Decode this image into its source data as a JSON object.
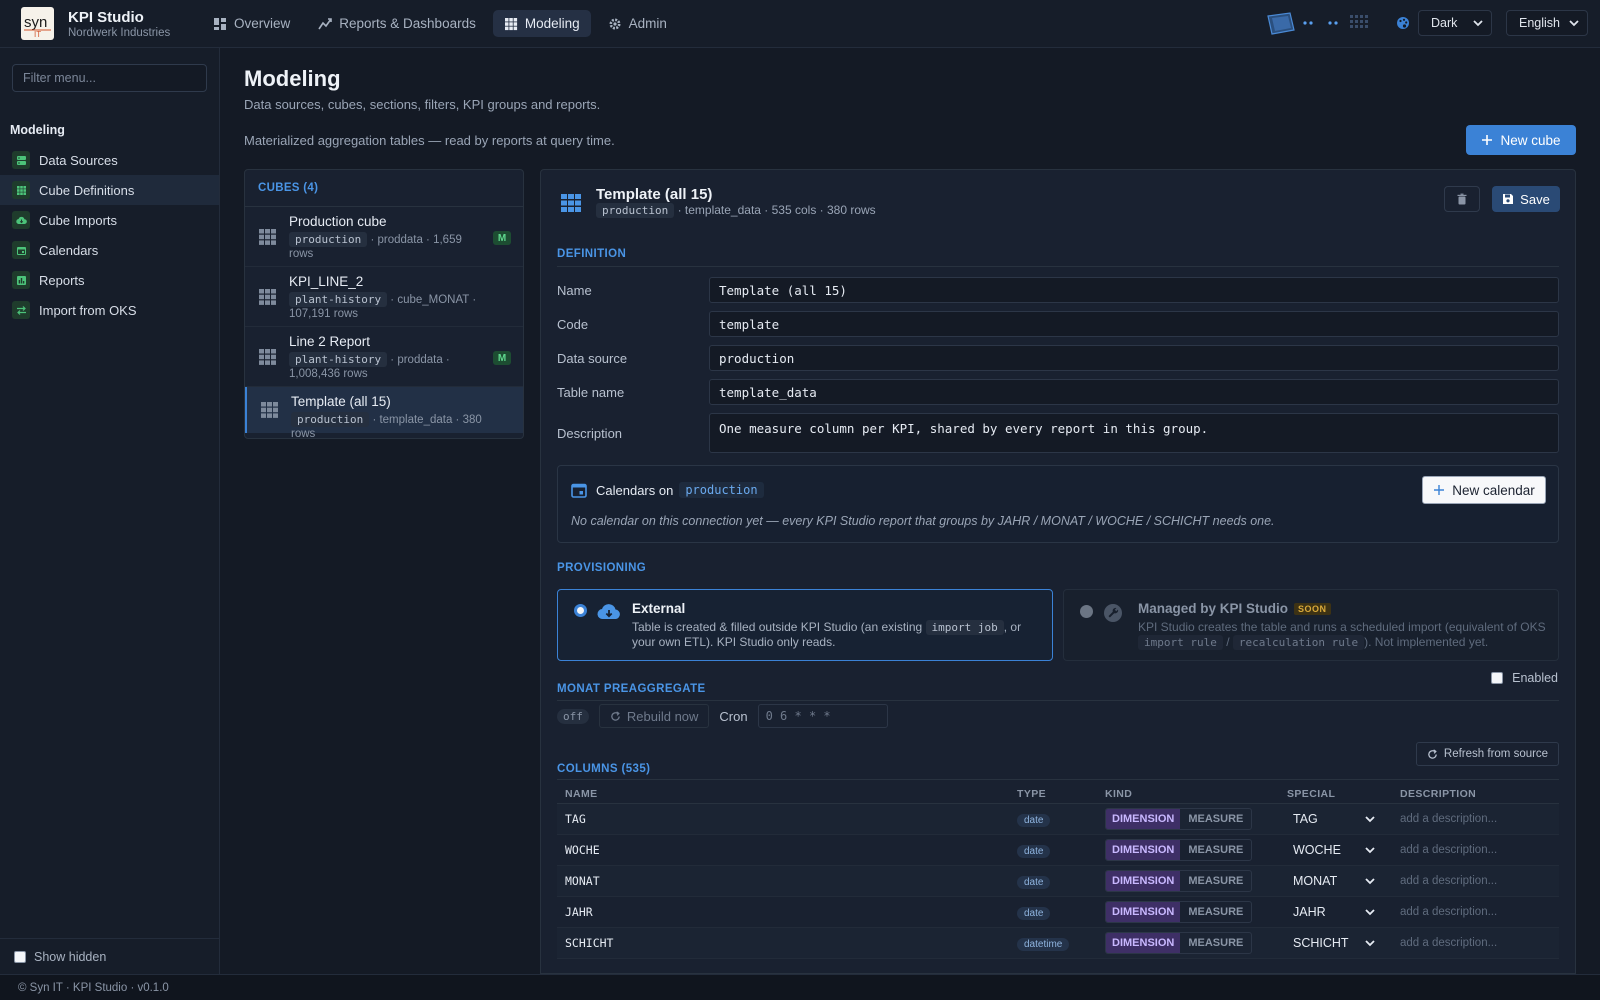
{
  "app": {
    "title": "KPI Studio",
    "subtitle": "Nordwerk Industries",
    "logo_text": "syn IT"
  },
  "nav": {
    "tabs": [
      {
        "label": "Overview",
        "icon": "grid-icon"
      },
      {
        "label": "Reports & Dashboards",
        "icon": "chart-line-icon"
      },
      {
        "label": "Modeling",
        "icon": "cube-grid-icon"
      },
      {
        "label": "Admin",
        "icon": "gear-icon"
      }
    ]
  },
  "top": {
    "theme": "Dark",
    "language": "English"
  },
  "sidebar": {
    "filter_placeholder": "Filter menu...",
    "heading": "Modeling",
    "items": [
      {
        "label": "Data Sources"
      },
      {
        "label": "Cube Definitions"
      },
      {
        "label": "Cube Imports"
      },
      {
        "label": "Calendars"
      },
      {
        "label": "Reports"
      },
      {
        "label": "Import from OKS"
      }
    ],
    "show_hidden": "Show hidden"
  },
  "page": {
    "title": "Modeling",
    "subtitle": "Data sources, cubes, sections, filters, KPI groups and reports.",
    "description": "Materialized aggregation tables — read by reports at query time.",
    "new_cube": "New cube"
  },
  "cubes": {
    "heading": "CUBES (4)",
    "items": [
      {
        "name": "Production cube",
        "code": "production",
        "meta1": "· proddata · 1,659",
        "meta2": "rows",
        "badge": "M"
      },
      {
        "name": "KPI_LINE_2",
        "code": "plant-history",
        "meta1": "· cube_MONAT ·",
        "meta2": "107,191 rows",
        "badge": ""
      },
      {
        "name": "Line 2 Report",
        "code": "plant-history",
        "meta1": "· proddata ·",
        "meta2": "1,008,436 rows",
        "badge": "M"
      },
      {
        "name": "Template (all 15)",
        "code": "production",
        "meta1": "· template_data · 380 rows",
        "meta2": "",
        "badge": ""
      }
    ]
  },
  "detail": {
    "title": "Template (all 15)",
    "code": "production",
    "meta": "· template_data · 535 cols · 380 rows",
    "save": "Save",
    "definition_heading": "DEFINITION",
    "fields": {
      "name_label": "Name",
      "name_value": "Template (all 15)",
      "code_label": "Code",
      "code_value": "template",
      "ds_label": "Data source",
      "ds_value": "production",
      "table_label": "Table name",
      "table_value": "template_data",
      "desc_label": "Description",
      "desc_value": "One measure column per KPI, shared by every report in this group."
    },
    "calendars": {
      "title": "Calendars on",
      "code": "production",
      "new_calendar": "New calendar",
      "note": "No calendar on this connection yet — every KPI Studio report that groups by JAHR / MONAT / WOCHE / SCHICHT needs one."
    },
    "provisioning": {
      "heading": "PROVISIONING",
      "external_title": "External",
      "external_desc_a": "Table is created & filled outside KPI Studio (an existing",
      "external_code": "import job",
      "external_desc_b": ", or your own ETL). KPI Studio only reads.",
      "managed_title": "Managed by KPI Studio",
      "managed_badge": "SOON",
      "managed_desc_a": "KPI Studio creates the table and runs a scheduled import (equivalent of OKS",
      "managed_code1": "import rule",
      "managed_sep": "/",
      "managed_code2": "recalculation rule",
      "managed_desc_b": "). Not implemented yet."
    },
    "preaggregate": {
      "heading": "MONAT PREAGGREGATE",
      "enabled_label": "Enabled",
      "status": "off",
      "rebuild": "Rebuild now",
      "cron_label": "Cron",
      "cron_value": "0 6 * * *"
    },
    "columns": {
      "heading": "COLUMNS (535)",
      "refresh": "Refresh from source",
      "headers": {
        "name": "NAME",
        "type": "TYPE",
        "kind": "KIND",
        "special": "SPECIAL",
        "description": "DESCRIPTION"
      },
      "kind_dim": "DIMENSION",
      "kind_mea": "MEASURE",
      "desc_placeholder": "add a description...",
      "rows": [
        {
          "name": "TAG",
          "type": "date",
          "special": "TAG"
        },
        {
          "name": "WOCHE",
          "type": "date",
          "special": "WOCHE"
        },
        {
          "name": "MONAT",
          "type": "date",
          "special": "MONAT"
        },
        {
          "name": "JAHR",
          "type": "date",
          "special": "JAHR"
        },
        {
          "name": "SCHICHT",
          "type": "datetime",
          "special": "SCHICHT"
        }
      ]
    }
  },
  "footer": "© Syn IT · KPI Studio · v0.1.0",
  "colors": {
    "accent": "#3b82d6",
    "success": "#5fd88e",
    "dimension": "#3e2f66"
  }
}
